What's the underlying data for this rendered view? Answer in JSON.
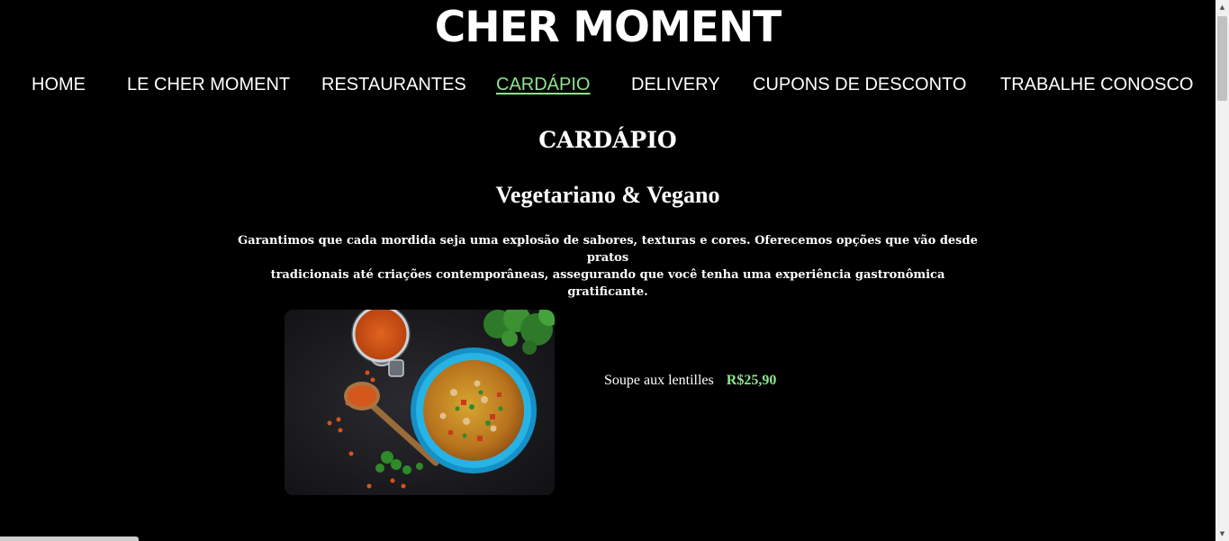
{
  "site": {
    "brand": "CHER MOMENT"
  },
  "nav": {
    "items": [
      {
        "label": "HOME"
      },
      {
        "label": "LE CHER MOMENT"
      },
      {
        "label": "RESTAURANTES"
      },
      {
        "label": "CARDÁPIO",
        "active": true
      },
      {
        "label": "DELIVERY"
      },
      {
        "label": "CUPONS DE DESCONTO"
      },
      {
        "label": "TRABALHE CONOSCO"
      }
    ]
  },
  "main": {
    "section_title": "CARDÁPIO",
    "category_title": "Vegetariano & Vegano",
    "intro_line1": "Garantimos que cada mordida seja uma explosão de sabores, texturas e cores. Oferecemos opções que vão desde pratos",
    "intro_line2": "tradicionais até criações contemporâneas, assegurando que você tenha uma experiência gastronômica gratificante.",
    "dishes": [
      {
        "name": "Soupe aux lentilles",
        "price": "R$25,90",
        "image_icon": "lentil-soup-photo"
      }
    ]
  },
  "colors": {
    "background": "#000000",
    "text": "#ffffff",
    "accent": "#8ee58e"
  }
}
